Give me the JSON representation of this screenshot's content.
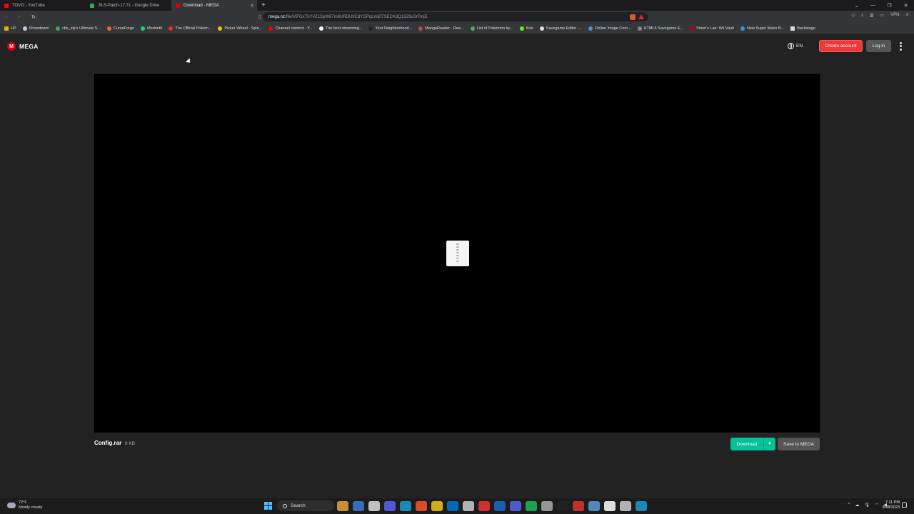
{
  "browser": {
    "tabs": [
      {
        "label": "TOVG - YouTube",
        "color": "#ff0000",
        "active": false
      },
      {
        "label": "JILS-Patch-17.7z - Google Drive",
        "color": "#34a853",
        "active": false
      },
      {
        "label": "Download - MEGA",
        "color": "#d90007",
        "active": true
      }
    ],
    "new_tab": "+",
    "url_host": "mega.nz",
    "url_path": "/file/ViFGxThY#Z1SpW67m8URDU9CdYGPqLmEf7SECKdQ1329uSrFmjE",
    "vpn_label": "VPN",
    "bookmarks": [
      {
        "label": "HP",
        "color": "#e8b000"
      },
      {
        "label": "Showdown!",
        "color": "#cccccc"
      },
      {
        "label": "cbk_zip's Ultimate S...",
        "color": "#34a853"
      },
      {
        "label": "CurseForge",
        "color": "#f16436"
      },
      {
        "label": "Modrinth",
        "color": "#1bd96a"
      },
      {
        "label": "The Official Pokém...",
        "color": "#e3350d"
      },
      {
        "label": "Picker Wheel - Spin...",
        "color": "#f5c400"
      },
      {
        "label": "Channel content - Y...",
        "color": "#ff0000"
      },
      {
        "label": "The best streaming...",
        "color": "#ffffff"
      },
      {
        "label": "Your Neighborhood...",
        "color": "#222222"
      },
      {
        "label": "MangaReader - Rea...",
        "color": "#c44"
      },
      {
        "label": "List of Pokémon by...",
        "color": "#5a5"
      },
      {
        "label": "Kick",
        "color": "#53fc18"
      },
      {
        "label": "Savegame Editor -...",
        "color": "#dddddd"
      },
      {
        "label": "Online Image Com...",
        "color": "#4a90d9"
      },
      {
        "label": "HTML5 Savegame E...",
        "color": "#888888"
      },
      {
        "label": "Vimm's Lair: Wii Vault",
        "color": "#b00"
      },
      {
        "label": "New Super Mario B...",
        "color": "#3a8ee6"
      },
      {
        "label": "Backstage",
        "color": "#dddddd"
      }
    ]
  },
  "header": {
    "logo_mark": "M",
    "logo_text": "MEGA",
    "lang": "EN",
    "create_account": "Create account",
    "login": "Log in"
  },
  "file": {
    "name": "Config.rar",
    "size": "9 KB"
  },
  "actions": {
    "download": "Download",
    "save": "Save to MEGA"
  },
  "taskbar": {
    "weather_temp": "72°F",
    "weather_desc": "Mostly cloudy",
    "search_placeholder": "Search",
    "time": "7:11 PM",
    "date": "9/28/2023",
    "apps": [
      "#e8a33d",
      "#3a7bd5",
      "#dddddd",
      "#5865f2",
      "#1b9bd1",
      "#fb542b",
      "#f5c518",
      "#0078d4",
      "#cccccc",
      "#e33",
      "#1b6ac9",
      "#5865f2",
      "#1db954",
      "#aaaaaa",
      "#222222",
      "#d33",
      "#5a9bd5",
      "#ffffff",
      "#ccc",
      "#1b9bd1"
    ]
  }
}
